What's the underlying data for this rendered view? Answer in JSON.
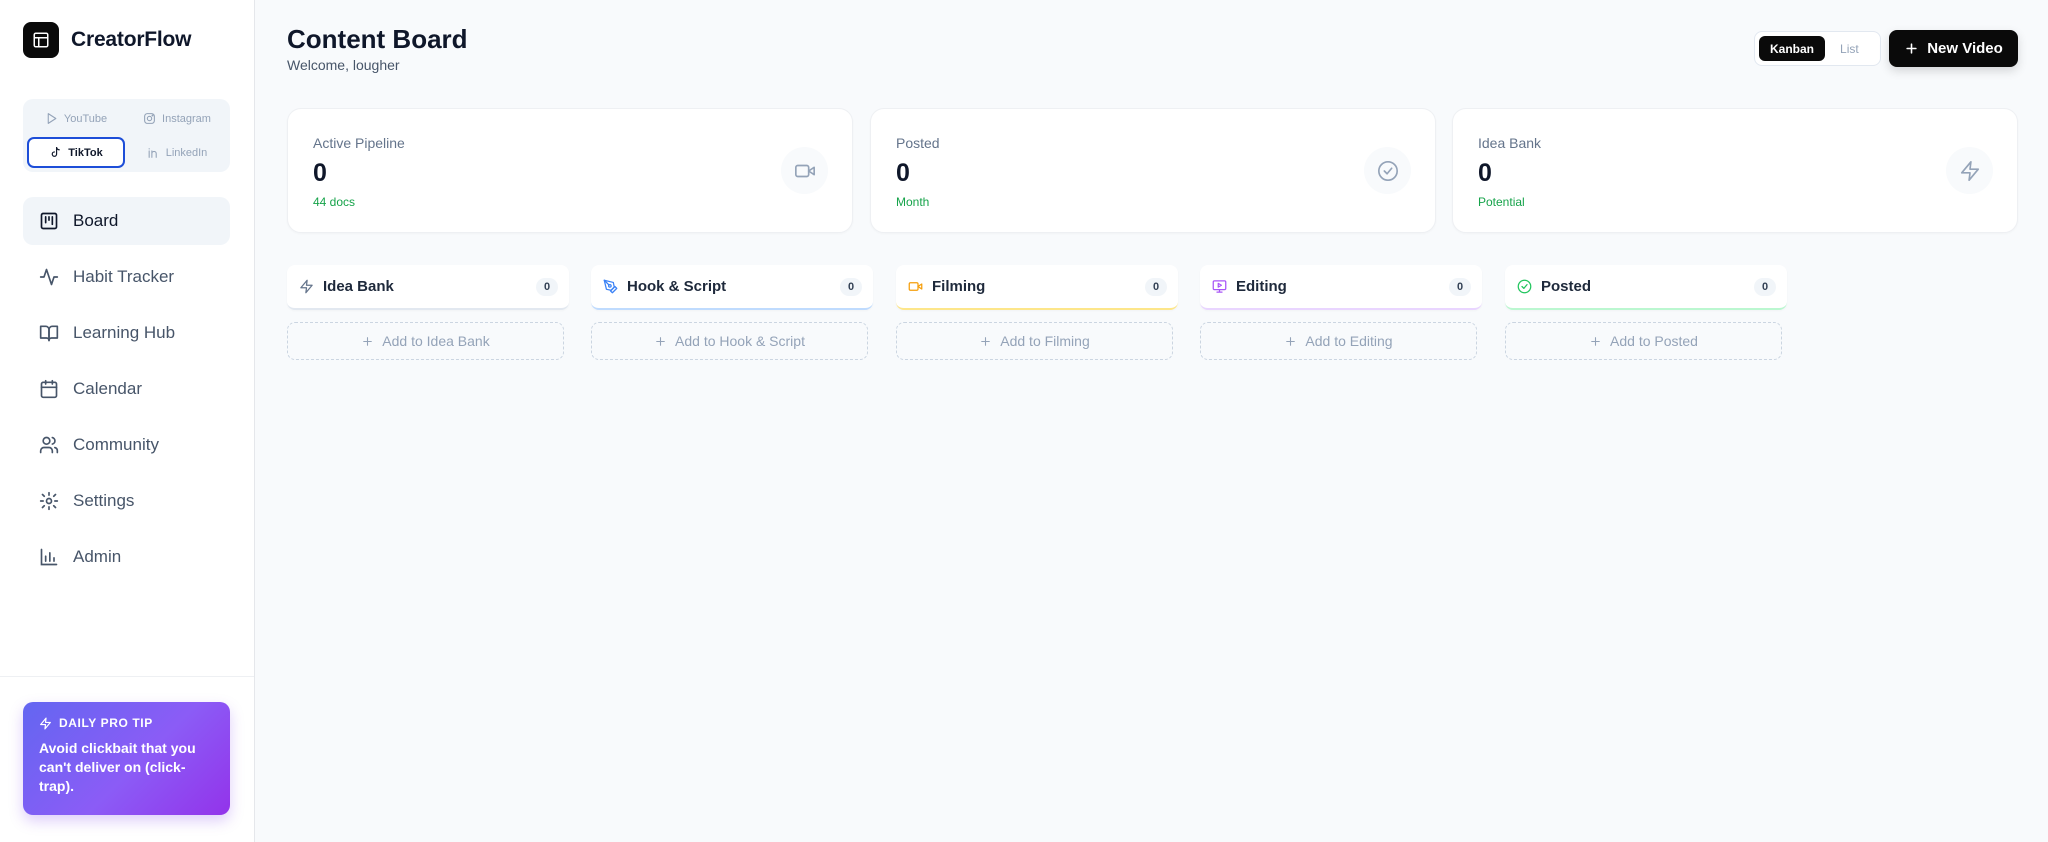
{
  "app": {
    "name": "CreatorFlow"
  },
  "platforms": [
    {
      "label": "YouTube",
      "icon": "play-icon",
      "active": false
    },
    {
      "label": "Instagram",
      "icon": "instagram-icon",
      "active": false
    },
    {
      "label": "TikTok",
      "icon": "music-note-icon",
      "active": true
    },
    {
      "label": "LinkedIn",
      "icon": "linkedin-icon",
      "active": false
    }
  ],
  "nav": [
    {
      "label": "Board",
      "icon": "kanban-icon",
      "active": true
    },
    {
      "label": "Habit Tracker",
      "icon": "activity-icon",
      "active": false
    },
    {
      "label": "Learning Hub",
      "icon": "book-open-icon",
      "active": false
    },
    {
      "label": "Calendar",
      "icon": "calendar-icon",
      "active": false
    },
    {
      "label": "Community",
      "icon": "users-icon",
      "active": false
    },
    {
      "label": "Settings",
      "icon": "gear-icon",
      "active": false
    },
    {
      "label": "Admin",
      "icon": "bar-chart-icon",
      "active": false
    }
  ],
  "tip": {
    "heading": "DAILY PRO TIP",
    "text": "Avoid clickbait that you can't deliver on (click-trap)."
  },
  "header": {
    "title": "Content Board",
    "subtitle": "Welcome, lougher"
  },
  "view_toggle": {
    "kanban": "Kanban",
    "list": "List",
    "selected": "Kanban"
  },
  "new_video_label": "New Video",
  "stats": [
    {
      "label": "Active Pipeline",
      "value": "0",
      "sub": "44 docs",
      "icon": "video-camera-icon"
    },
    {
      "label": "Posted",
      "value": "0",
      "sub": "Month",
      "icon": "check-circle-icon"
    },
    {
      "label": "Idea Bank",
      "value": "0",
      "sub": "Potential",
      "icon": "lightning-icon"
    }
  ],
  "columns": [
    {
      "title": "Idea Bank",
      "count": "0",
      "add_label": "Add to Idea Bank",
      "icon": "lightning-icon",
      "color": "#64748b"
    },
    {
      "title": "Hook & Script",
      "count": "0",
      "add_label": "Add to Hook & Script",
      "icon": "pen-tool-icon",
      "color": "#3b82f6"
    },
    {
      "title": "Filming",
      "count": "0",
      "add_label": "Add to Filming",
      "icon": "video-camera-icon",
      "color": "#f59e0b"
    },
    {
      "title": "Editing",
      "count": "0",
      "add_label": "Add to Editing",
      "icon": "monitor-play-icon",
      "color": "#a855f7"
    },
    {
      "title": "Posted",
      "count": "0",
      "add_label": "Add to Posted",
      "icon": "check-circle-icon",
      "color": "#22c55e"
    }
  ],
  "colors": {
    "accent": "#0a0a0a",
    "active_platform_border": "#1d4ed8",
    "positive": "#16a34a",
    "tip_gradient_start": "#6366f1",
    "tip_gradient_end": "#9333ea"
  }
}
